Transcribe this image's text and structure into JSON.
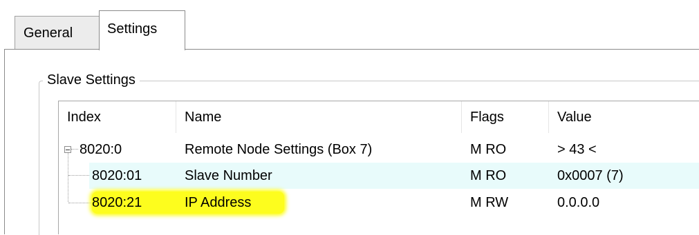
{
  "tabs": [
    {
      "label": "General"
    },
    {
      "label": "Settings"
    }
  ],
  "group": {
    "title": "Slave Settings"
  },
  "table": {
    "columns": [
      "Index",
      "Name",
      "Flags",
      "Value"
    ],
    "rows": [
      {
        "index": "8020:0",
        "name": "Remote Node Settings (Box 7)",
        "flags": "M RO",
        "value": "> 43 <"
      },
      {
        "index": "8020:01",
        "name": "Slave Number",
        "flags": "M RO",
        "value": "0x0007 (7)"
      },
      {
        "index": "8020:21",
        "name": "IP Address",
        "flags": "M RW",
        "value": "0.0.0.0"
      }
    ]
  },
  "colors": {
    "highlight": "#fdfd1e",
    "selected_row": "#e8fbfb"
  }
}
